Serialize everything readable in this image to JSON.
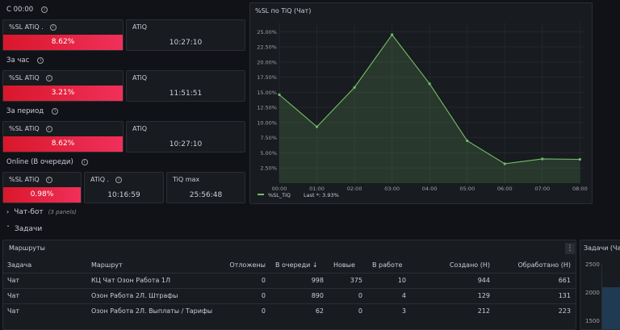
{
  "sections": {
    "s00": "С 00:00",
    "hour": "За час",
    "period": "За период",
    "online": "Online (В очереди)"
  },
  "stats": {
    "s00_sl": {
      "label": "%SL ATiQ .",
      "value": "8.62%"
    },
    "s00_atiq": {
      "label": "ATiQ",
      "value": "10:27:10"
    },
    "hour_sl": {
      "label": "%SL ATiQ",
      "value": "3.21%"
    },
    "hour_atiq": {
      "label": "ATiQ",
      "value": "11:51:51"
    },
    "period_sl": {
      "label": "%SL ATiQ",
      "value": "8.62%"
    },
    "period_atiq": {
      "label": "ATiQ",
      "value": "10:27:10"
    },
    "online_sl": {
      "label": "%SL ATiQ",
      "value": "0.98%"
    },
    "online_atiq": {
      "label": "ATiQ .",
      "value": "10:16:59"
    },
    "online_tiqmax": {
      "label": "TiQ max",
      "value": "25:56:48"
    }
  },
  "chart_panel": {
    "title": "%SL по TiQ (Чат)",
    "legend_series": "%SL_TiQ",
    "legend_last": "Last *: 3.93%",
    "series_color": "#73bf69"
  },
  "chart_data": {
    "type": "area",
    "x": [
      "00:00",
      "01:00",
      "02:00",
      "03:00",
      "04:00",
      "05:00",
      "06:00",
      "07:00",
      "08:00"
    ],
    "x_hours": [
      0,
      1,
      2,
      3,
      4,
      5,
      6,
      7,
      8,
      8.1
    ],
    "series": [
      {
        "name": "%SL_TiQ",
        "values": [
          14.6,
          9.3,
          15.8,
          24.5,
          16.4,
          7.0,
          3.2,
          4.0,
          3.93
        ]
      }
    ],
    "y_ticks": [
      "2.50%",
      "5.00%",
      "7.50%",
      "10.00%",
      "12.50%",
      "15.00%",
      "17.50%",
      "20.00%",
      "22.50%",
      "25.00%"
    ],
    "ylim": [
      0,
      26.5
    ]
  },
  "rows": {
    "chatbot": {
      "label": "Чат-бот",
      "note": "(3 panels)"
    },
    "tasks": {
      "label": "Задачи"
    }
  },
  "routes_panel": {
    "title": "Маршруты",
    "menu": "⋮",
    "columns": [
      "Задача",
      "Маршрут",
      "Отложены",
      "В очереди ↓",
      "Новые",
      "В работе",
      "Создано (Н)",
      "Обработано (Н)"
    ],
    "rows": [
      [
        "Чат",
        "КЦ Чат Озон Работа 1Л",
        "0",
        "998",
        "375",
        "10",
        "944",
        "661"
      ],
      [
        "Чат",
        "Озон Работа 2Л. Штрафы",
        "0",
        "890",
        "0",
        "4",
        "129",
        "131"
      ],
      [
        "Чат",
        "Озон Работа 2Л. Выплаты / Тарифы",
        "0",
        "62",
        "0",
        "3",
        "212",
        "223"
      ]
    ]
  },
  "tasks_panel": {
    "title": "Задачи (Чат",
    "y_ticks": [
      "2500",
      "2000",
      "1500"
    ]
  }
}
